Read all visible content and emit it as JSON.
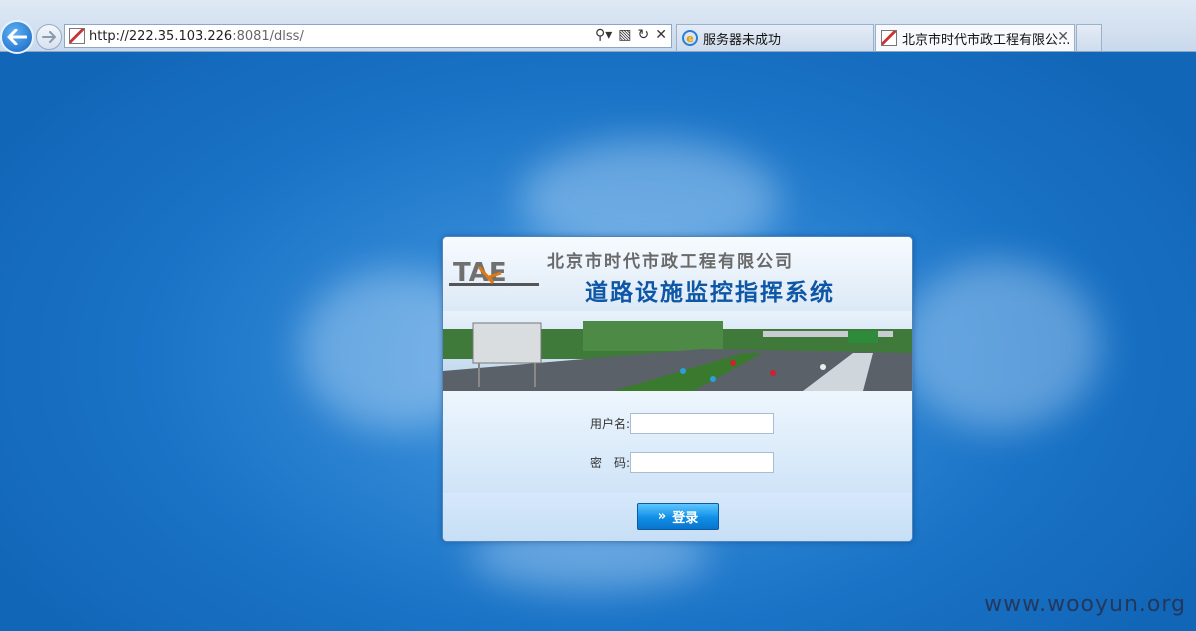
{
  "browser": {
    "url_host": "http://222.35.103.226",
    "url_rest": ":8081/dlss/",
    "tabs": [
      {
        "label": "服务器未成功"
      },
      {
        "label": "北京市时代市政工程有限公..."
      }
    ]
  },
  "banner": {
    "company": "北京市时代市政工程有限公司",
    "system_title": "道路设施监控指挥系统",
    "logo_text": "TAE"
  },
  "login": {
    "username_label": "用户名:",
    "password_label": "密　码:",
    "username_value": "",
    "password_value": "",
    "submit_label": "登录"
  },
  "watermark": "www.wooyun.org",
  "colors": {
    "title_blue": "#0d57a6",
    "background_blue": "#1a73c6",
    "button_blue": "#0f8ee6"
  }
}
